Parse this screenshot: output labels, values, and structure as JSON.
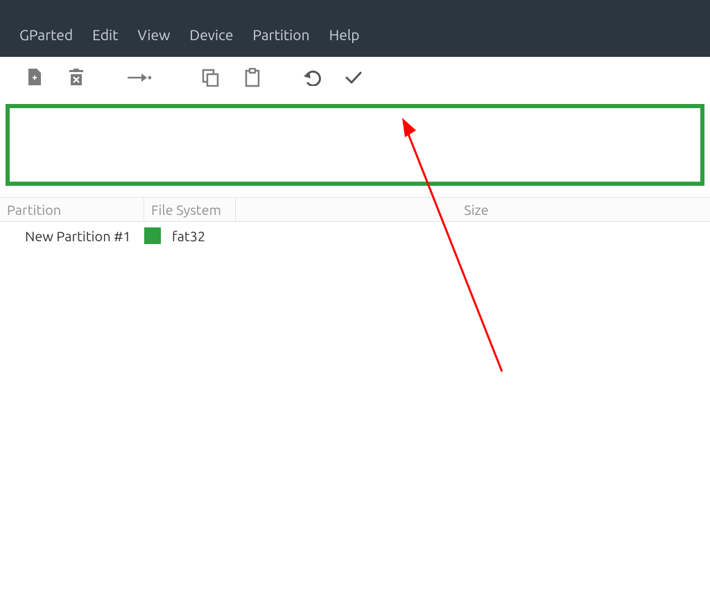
{
  "menubar": {
    "items": [
      "GParted",
      "Edit",
      "View",
      "Device",
      "Partition",
      "Help"
    ]
  },
  "toolbar": {
    "icons": {
      "new": "new-partition-icon",
      "delete": "delete-icon",
      "resize": "resize-move-icon",
      "copy": "copy-icon",
      "paste": "paste-icon",
      "undo": "undo-icon",
      "apply": "apply-icon"
    }
  },
  "partition_visual": {
    "border_color": "#2e9e3f"
  },
  "table": {
    "columns": {
      "partition": "Partition",
      "filesystem": "File System",
      "size": "Size"
    },
    "rows": [
      {
        "partition": "New Partition #1",
        "fs_name": "fat32",
        "fs_color": "#2e9e3f"
      }
    ]
  }
}
